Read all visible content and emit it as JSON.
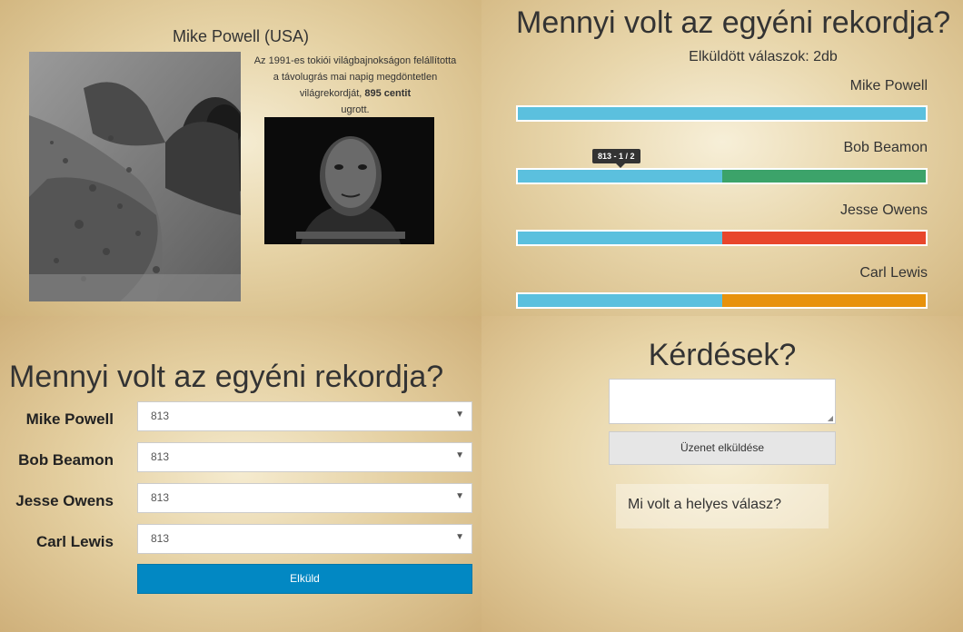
{
  "athlete": {
    "name": "Mike Powell (USA)",
    "bio_before": "Az 1991-es tokiói világbajnokságon felállította a távolugrás mai napig megdöntetlen világrekordját,",
    "bio_bold": "895 centit",
    "bio_after": "ugrott."
  },
  "results": {
    "title": "Mennyi volt az egyéni rekordja?",
    "answers_count": "Elküldött válaszok: 2db",
    "tooltip": "813 - 1 / 2"
  },
  "chart_data": {
    "type": "bar",
    "title": "Mennyi volt az egyéni rekordja?",
    "orientation": "horizontal-stacked",
    "categories": [
      "Mike Powell",
      "Bob Beamon",
      "Jesse Owens",
      "Carl Lewis"
    ],
    "series": [
      {
        "values": [
          1.0,
          0.5,
          0.5,
          0.5
        ],
        "color": "#5bc0de"
      },
      {
        "values": [
          0,
          0.5,
          0,
          0
        ],
        "color": "#3ca36a"
      },
      {
        "values": [
          0,
          0,
          0.5,
          0
        ],
        "color": "#e8462c"
      },
      {
        "values": [
          0,
          0,
          0,
          0.5
        ],
        "color": "#e8920c"
      }
    ],
    "xlim": [
      0,
      1
    ]
  },
  "form": {
    "title": "Mennyi volt az egyéni rekordja?",
    "fields": [
      {
        "label": "Mike Powell",
        "value": "813"
      },
      {
        "label": "Bob Beamon",
        "value": "813"
      },
      {
        "label": "Jesse Owens",
        "value": "813"
      },
      {
        "label": "Carl Lewis",
        "value": "813"
      }
    ],
    "submit_label": "Elküld"
  },
  "questions": {
    "title": "Kérdések?",
    "textarea_value": "",
    "send_label": "Üzenet elküldése",
    "items": [
      "Mi volt a helyes válasz?"
    ]
  }
}
